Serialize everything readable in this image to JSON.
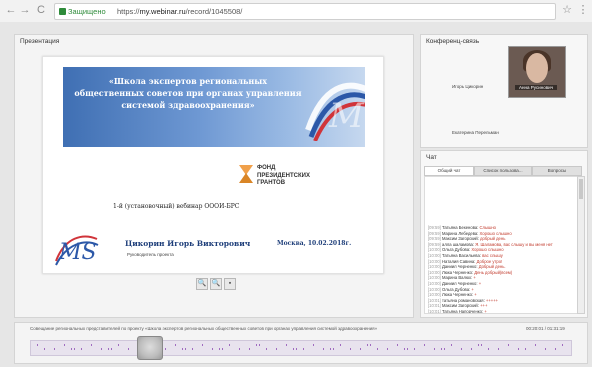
{
  "browser": {
    "back": "←",
    "forward": "→",
    "reload": "C",
    "secure_label": "Защищено",
    "url_scheme": "https://",
    "url_host": "my.webinar.ru",
    "url_path": "/record/1045508/",
    "star": "☆",
    "menu": "⋮"
  },
  "presentation": {
    "title": "Презентация",
    "slide": {
      "banner_text": "«Школа экспертов региональных общественных советов при органах управления системой здравоохранения»",
      "fond_text": "ФОНД\nПРЕЗИДЕНТСКИХ\nГРАНТОВ",
      "webinar_line": "1-й (установочный) вебинар ОООИ-БРС",
      "speaker_name": "Цикорин Игорь Викторович",
      "speaker_role": "Руководитель проекта",
      "city_date": "Москва, 10.02.2018г."
    },
    "controls": {
      "zoom_in": "🔍",
      "zoom_out": "🔍",
      "save": "▪"
    }
  },
  "conference": {
    "title": "Конференц-связь",
    "participant_1": "Игорь Цикорин",
    "participant_2": "Екатерина Перельман",
    "video_name": "Анна Русинович"
  },
  "chat": {
    "title": "Чат",
    "tabs": [
      "Общий чат",
      "Список пользова...",
      "Вопросы"
    ],
    "messages": [
      {
        "time": "[09:59]",
        "user": "Татьяна Бекенова:",
        "text": "Слышно"
      },
      {
        "time": "[09:59]",
        "user": "Марина Лебедева:",
        "text": "Хорошо слышно"
      },
      {
        "time": "[09:59]",
        "user": "Максим Загорский:",
        "text": "добрый день"
      },
      {
        "time": "[09:59]",
        "user": "алла шаламова:",
        "text": "Я. Шаламова, вас слышу и вы меня нет"
      },
      {
        "time": "[10:00]",
        "user": "Ольга Дубова:",
        "text": "Хорошо слышно"
      },
      {
        "time": "[10:00]",
        "user": "Татьяна Васильева:",
        "text": "вас слышу"
      },
      {
        "time": "[10:00]",
        "user": "Наталия Савина:",
        "text": "Доброе утро!"
      },
      {
        "time": "[10:00]",
        "user": "Даниил Черненко:",
        "text": "Добрый день."
      },
      {
        "time": "[10:00]",
        "user": "Люка Черненко:",
        "text": "День добрый(всем)"
      },
      {
        "time": "[10:00]",
        "user": "Марина Валюх:",
        "text": "+"
      },
      {
        "time": "[10:00]",
        "user": "Даниил Черненко:",
        "text": "+"
      },
      {
        "time": "[10:00]",
        "user": "Ольга Дубова:",
        "text": "+"
      },
      {
        "time": "[10:00]",
        "user": "Люка Черненко:",
        "text": "+"
      },
      {
        "time": "[10:01]",
        "user": "татьяна романовская:",
        "text": "+++++"
      },
      {
        "time": "[10:01]",
        "user": "Максим Загорский:",
        "text": "+++"
      },
      {
        "time": "[10:01]",
        "user": "Татьяна Напорченко:",
        "text": "+"
      }
    ]
  },
  "timeline": {
    "title": "Совещание региональных представителей по проекту «Школа экспертов региональных общественных советов при органах управления системой здравоохранения»",
    "time": "00:20:01 / 01:31:19",
    "progress": 0.22
  }
}
